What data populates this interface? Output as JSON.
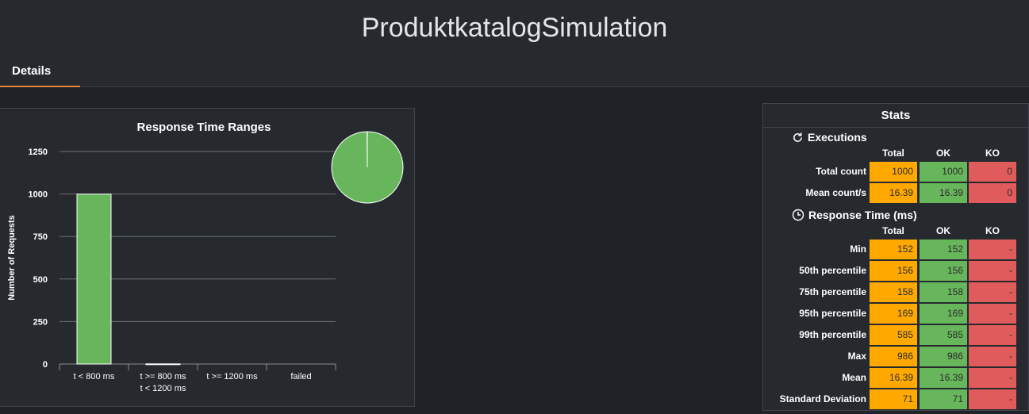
{
  "page": {
    "title": "ProduktkatalogSimulation",
    "tab_label": "Details"
  },
  "colors": {
    "ok": "#68b65c",
    "total": "#ffa900",
    "ko": "#e05b5b",
    "accent": "#e8833a"
  },
  "chart_data": {
    "type": "bar",
    "title": "Response Time Ranges",
    "ylabel": "Number of Requests",
    "xlabel": "",
    "ylim": [
      0,
      1250
    ],
    "yticks": [
      "0",
      "250",
      "500",
      "750",
      "1000",
      "1250"
    ],
    "categories": [
      "t < 800 ms",
      "t >= 800 ms\nt < 1200 ms",
      "t >= 1200 ms",
      "failed"
    ],
    "values": [
      999,
      1,
      0,
      0
    ],
    "grid": true,
    "pie": {
      "type": "pie",
      "slices": [
        {
          "label": "t < 800 ms",
          "value": 999
        },
        {
          "label": "t >= 800 ms t < 1200 ms",
          "value": 1
        },
        {
          "label": "t >= 1200 ms",
          "value": 0
        },
        {
          "label": "failed",
          "value": 0
        }
      ],
      "placement": "top-right"
    }
  },
  "stats": {
    "title": "Stats",
    "columns": [
      "Total",
      "OK",
      "KO"
    ],
    "executions": {
      "title": "Executions",
      "rows": [
        {
          "label": "Total count",
          "total": "1000",
          "ok": "1000",
          "ko": "0"
        },
        {
          "label": "Mean count/s",
          "total": "16.39",
          "ok": "16.39",
          "ko": "0"
        }
      ]
    },
    "response_time": {
      "title": "Response Time (ms)",
      "rows": [
        {
          "label": "Min",
          "total": "152",
          "ok": "152",
          "ko": "-"
        },
        {
          "label": "50th percentile",
          "total": "156",
          "ok": "156",
          "ko": "-"
        },
        {
          "label": "75th percentile",
          "total": "158",
          "ok": "158",
          "ko": "-"
        },
        {
          "label": "95th percentile",
          "total": "169",
          "ok": "169",
          "ko": "-"
        },
        {
          "label": "99th percentile",
          "total": "585",
          "ok": "585",
          "ko": "-"
        },
        {
          "label": "Max",
          "total": "986",
          "ok": "986",
          "ko": "-"
        },
        {
          "label": "Mean",
          "total": "16.39",
          "ok": "16.39",
          "ko": "-"
        },
        {
          "label": "Standard Deviation",
          "total": "71",
          "ok": "71",
          "ko": "-"
        }
      ]
    }
  }
}
